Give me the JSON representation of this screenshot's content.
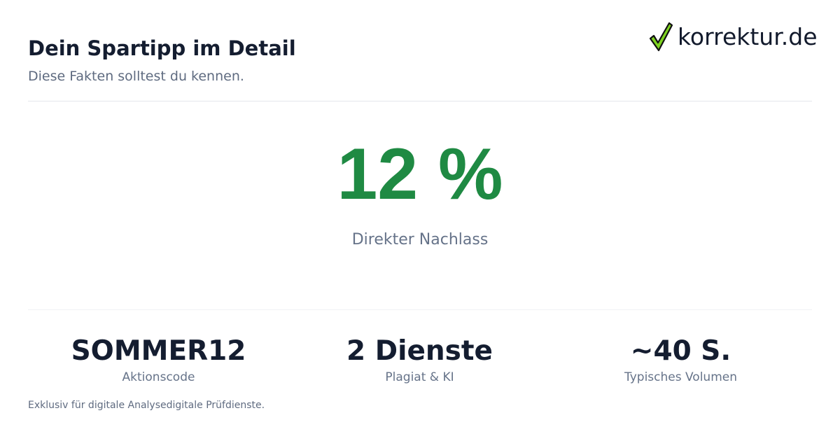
{
  "header": {
    "title": "Dein Spartipp im Detail",
    "subtitle": "Diese Fakten solltest du kennen."
  },
  "brand": {
    "logo_text": "korrektur.de",
    "check_fill": "#7ed321",
    "check_outline": "#111111"
  },
  "hero": {
    "value": "12 %",
    "label": "Direkter Nachlass",
    "color": "#1f8a43"
  },
  "stats": [
    {
      "value": "SOMMER12",
      "label": "Aktionscode"
    },
    {
      "value": "2 Dienste",
      "label": "Plagiat & KI"
    },
    {
      "value": "~40 S.",
      "label": "Typisches Volumen"
    }
  ],
  "footnote": "Exklusiv für digitale Analysedigitale Prüfdienste."
}
